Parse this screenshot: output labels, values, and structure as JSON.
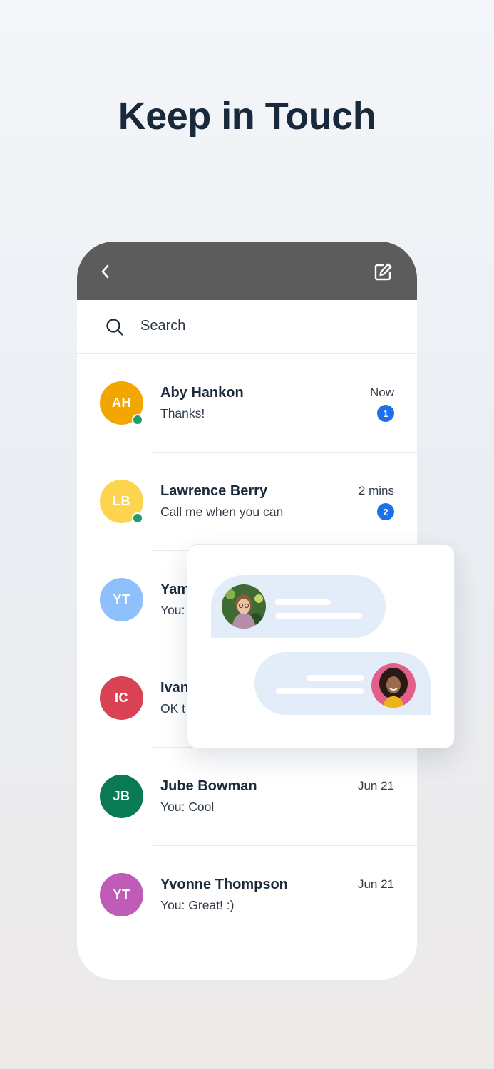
{
  "headline": "Keep in Touch",
  "header": {
    "back_icon": "chevron-left-icon",
    "compose_icon": "compose-edit-icon",
    "background": "#5c5c5c"
  },
  "search": {
    "placeholder": "Search",
    "icon": "search-icon"
  },
  "conversations": [
    {
      "initials": "AH",
      "name": "Aby Hankon",
      "preview": "Thanks!",
      "time": "Now",
      "unread": "1",
      "online": true,
      "color": "#f4a600"
    },
    {
      "initials": "LB",
      "name": "Lawrence Berry",
      "preview": "Call me when you can",
      "time": "2 mins",
      "unread": "2",
      "online": true,
      "color": "#fdd44e"
    },
    {
      "initials": "YT",
      "name": "Yam",
      "preview": "You:",
      "time": "",
      "unread": "",
      "online": false,
      "color": "#8ec0fb"
    },
    {
      "initials": "IC",
      "name": "Ivan",
      "preview": "OK t",
      "time": "",
      "unread": "",
      "online": false,
      "color": "#d94253"
    },
    {
      "initials": "JB",
      "name": "Jube Bowman",
      "preview": "You: Cool",
      "time": "Jun 21",
      "unread": "",
      "online": false,
      "color": "#0a7a55"
    },
    {
      "initials": "YT",
      "name": "Yvonne Thompson",
      "preview": "You: Great! :)",
      "time": "Jun 21",
      "unread": "",
      "online": false,
      "color": "#bf5cb8"
    }
  ],
  "colors": {
    "badge": "#1f6feb",
    "online": "#1f9d6a",
    "bubble": "#e3edf9"
  }
}
